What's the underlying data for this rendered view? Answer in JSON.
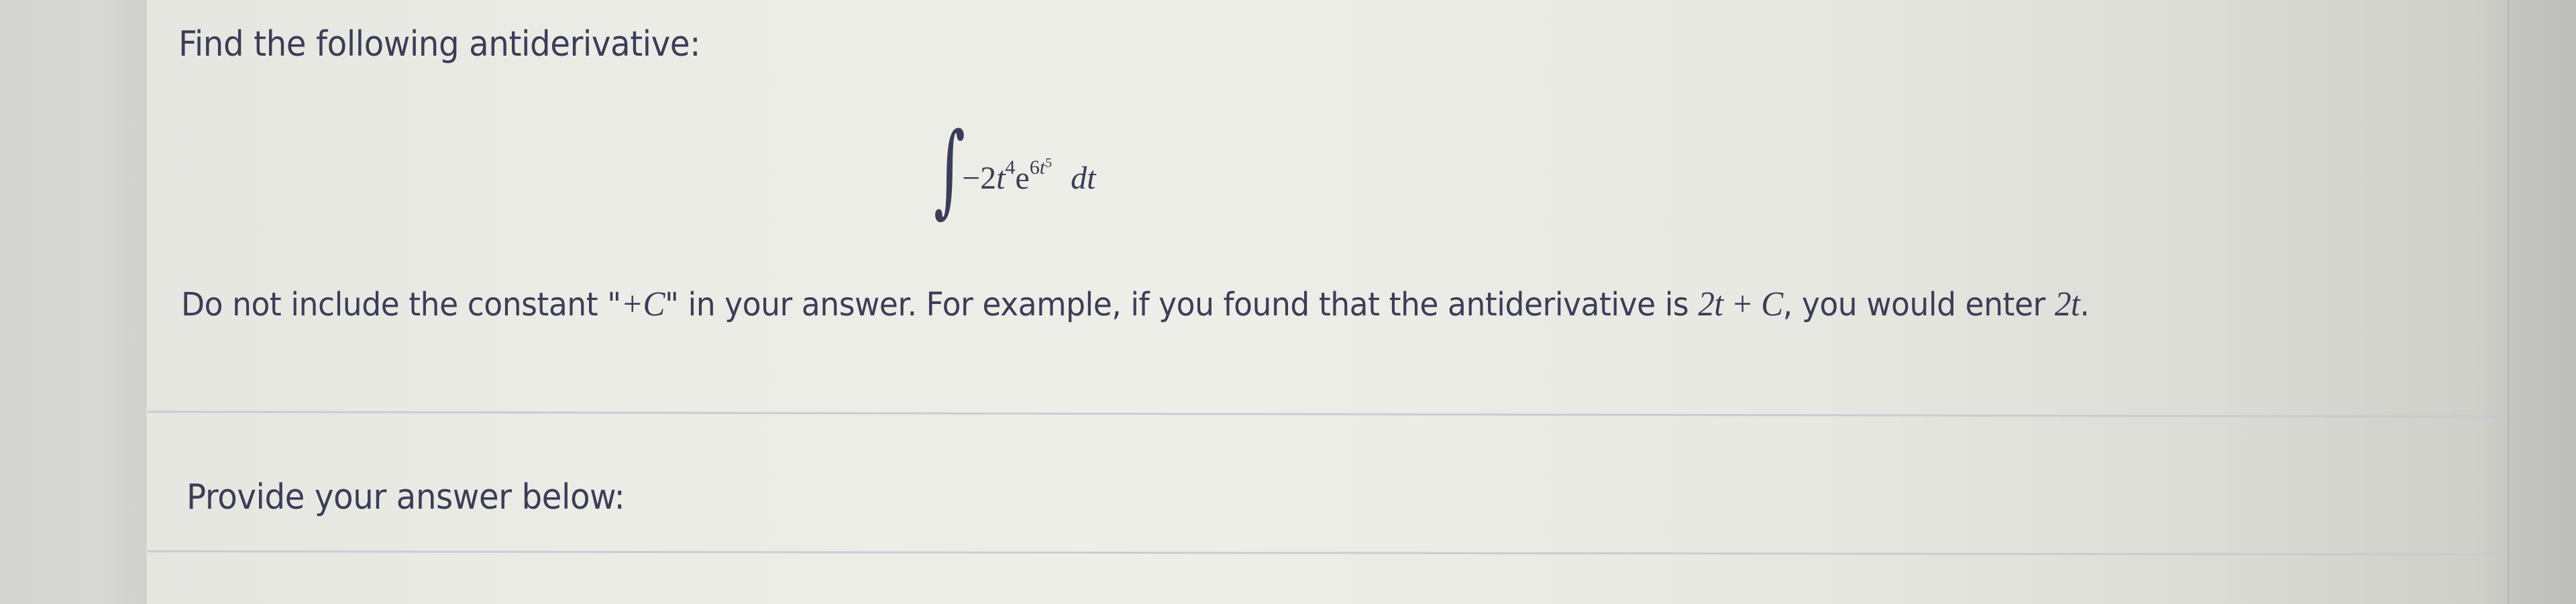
{
  "question": {
    "title": "Find the following antiderivative:",
    "integral": {
      "symbol": "∫",
      "integrand_coefficient": "−2",
      "integrand_var": "t",
      "integrand_var_exponent": "4",
      "base": "e",
      "exp_coefficient": "6",
      "exp_var": "t",
      "exp_var_exponent": "5",
      "differential": "dt"
    },
    "instructions": {
      "part1": "Do not include the constant \"",
      "plus_c": "+C",
      "part2": "\" in your answer. For example, if you found that the antiderivative is ",
      "example_expr": "2t + C",
      "part3": ", you would enter ",
      "example_answer": "2t",
      "part4": "."
    }
  },
  "answer": {
    "prompt": "Provide your answer below:",
    "value": ""
  }
}
